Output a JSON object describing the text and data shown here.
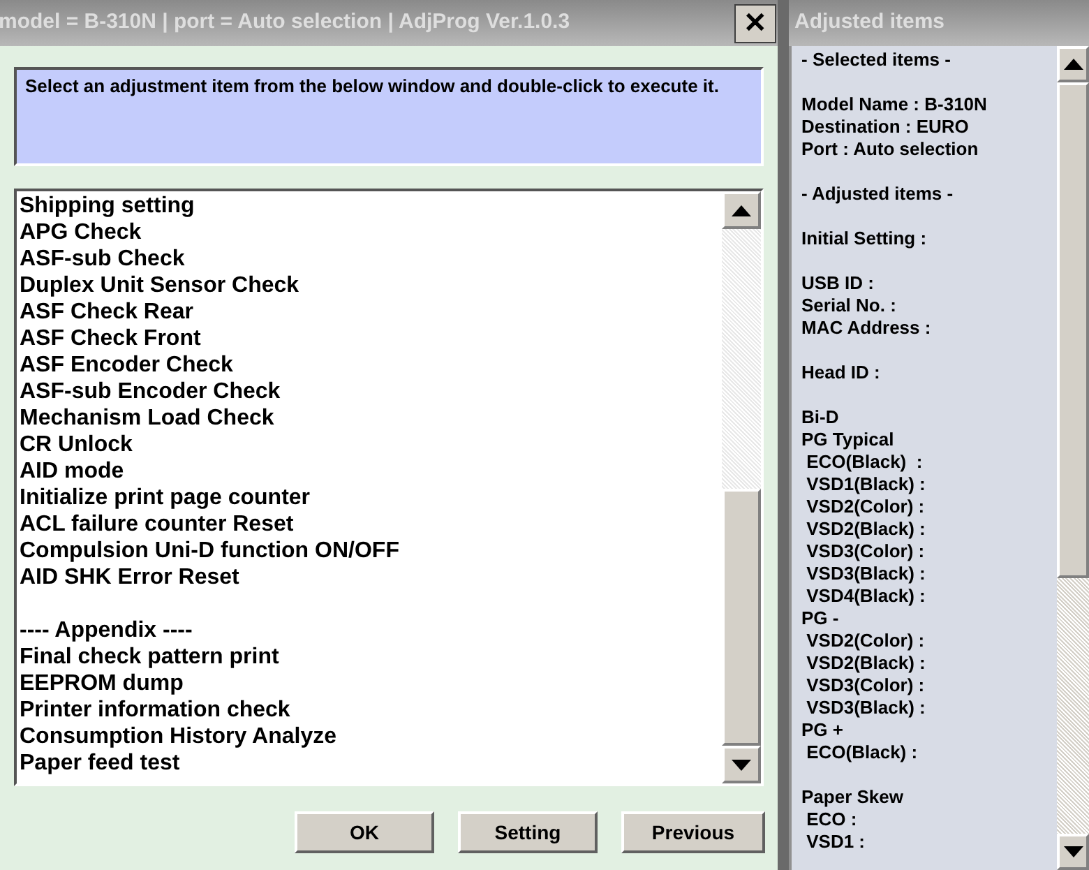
{
  "window": {
    "title": "model = B-310N | port = Auto selection | AdjProg Ver.1.0.3",
    "close": "✕"
  },
  "instruction": "Select an adjustment item from the below window and double-click to execute it.",
  "items": [
    {
      "label": "Shipping setting"
    },
    {
      "label": "APG Check"
    },
    {
      "label": "ASF-sub Check"
    },
    {
      "label": "Duplex Unit Sensor Check"
    },
    {
      "label": "ASF Check Rear"
    },
    {
      "label": "ASF Check Front"
    },
    {
      "label": "ASF Encoder Check"
    },
    {
      "label": "ASF-sub Encoder Check"
    },
    {
      "label": "Mechanism Load Check"
    },
    {
      "label": "CR Unlock"
    },
    {
      "label": "AID mode"
    },
    {
      "label": "Initialize print page counter"
    },
    {
      "label": "ACL failure counter Reset"
    },
    {
      "label": "Compulsion Uni-D function ON/OFF"
    },
    {
      "label": "AID SHK Error Reset"
    }
  ],
  "appendix": {
    "heading": "---- Appendix ----",
    "items": [
      {
        "label": "Final check pattern print"
      },
      {
        "label": "EEPROM dump"
      },
      {
        "label": "Printer information check"
      },
      {
        "label": "Consumption History Analyze"
      },
      {
        "label": "Paper feed test"
      }
    ]
  },
  "buttons": [
    "OK",
    "Setting",
    "Previous"
  ],
  "side_panel": {
    "title": "Adjusted items",
    "groups": [
      [
        "- Selected items -"
      ],
      [
        "Model Name : B-310N",
        "Destination : EURO",
        "Port : Auto selection"
      ],
      [
        "- Adjusted items -"
      ],
      [
        "Initial Setting :"
      ],
      [
        "USB ID :",
        "Serial No. :",
        "MAC Address :"
      ],
      [
        "Head ID :"
      ],
      [
        "Bi-D",
        "PG Typical",
        " ECO(Black)  :",
        " VSD1(Black) :",
        " VSD2(Color) :",
        " VSD2(Black) :",
        " VSD3(Color) :",
        " VSD3(Black) :",
        " VSD4(Black) :",
        "PG -",
        " VSD2(Color) :",
        " VSD2(Black) :",
        " VSD3(Color) :",
        " VSD3(Black) :",
        "PG +",
        " ECO(Black) :"
      ],
      [
        "Paper Skew",
        " ECO :",
        " VSD1 :"
      ]
    ]
  }
}
